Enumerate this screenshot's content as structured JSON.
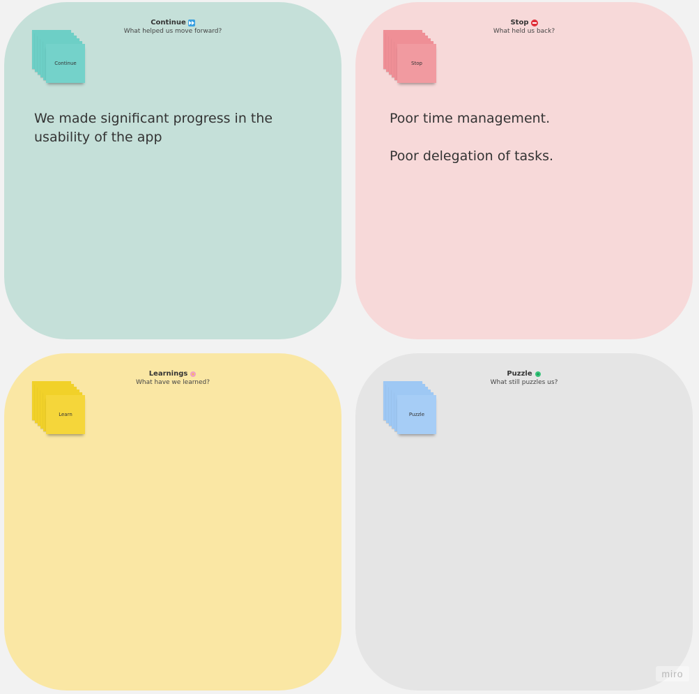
{
  "board": {
    "quadrants": {
      "continue": {
        "title": "Continue",
        "icon": "fast-forward-icon",
        "subtitle": "What helped us move forward?",
        "sticky_label": "Continue",
        "color": "#c5e0d9",
        "sticky_color": "#74d2ca",
        "notes": [
          "We made significant progress in the usability of the app"
        ]
      },
      "stop": {
        "title": "Stop",
        "icon": "no-entry-icon",
        "subtitle": "What held us back?",
        "sticky_label": "Stop",
        "color": "#f7d9d9",
        "sticky_color": "#f19aa0",
        "notes": [
          "Poor time management.",
          "Poor delegation of tasks."
        ]
      },
      "learnings": {
        "title": "Learnings",
        "icon": "flower-icon",
        "subtitle": "What have we learned?",
        "sticky_label": "Learn",
        "color": "#fae7a4",
        "sticky_color": "#f5d63a",
        "notes": []
      },
      "puzzle": {
        "title": "Puzzle",
        "icon": "clover-icon",
        "subtitle": "What still puzzles us?",
        "sticky_label": "Puzzle",
        "color": "#e5e5e5",
        "sticky_color": "#a6cdf6",
        "notes": []
      }
    }
  },
  "watermark": "miro"
}
